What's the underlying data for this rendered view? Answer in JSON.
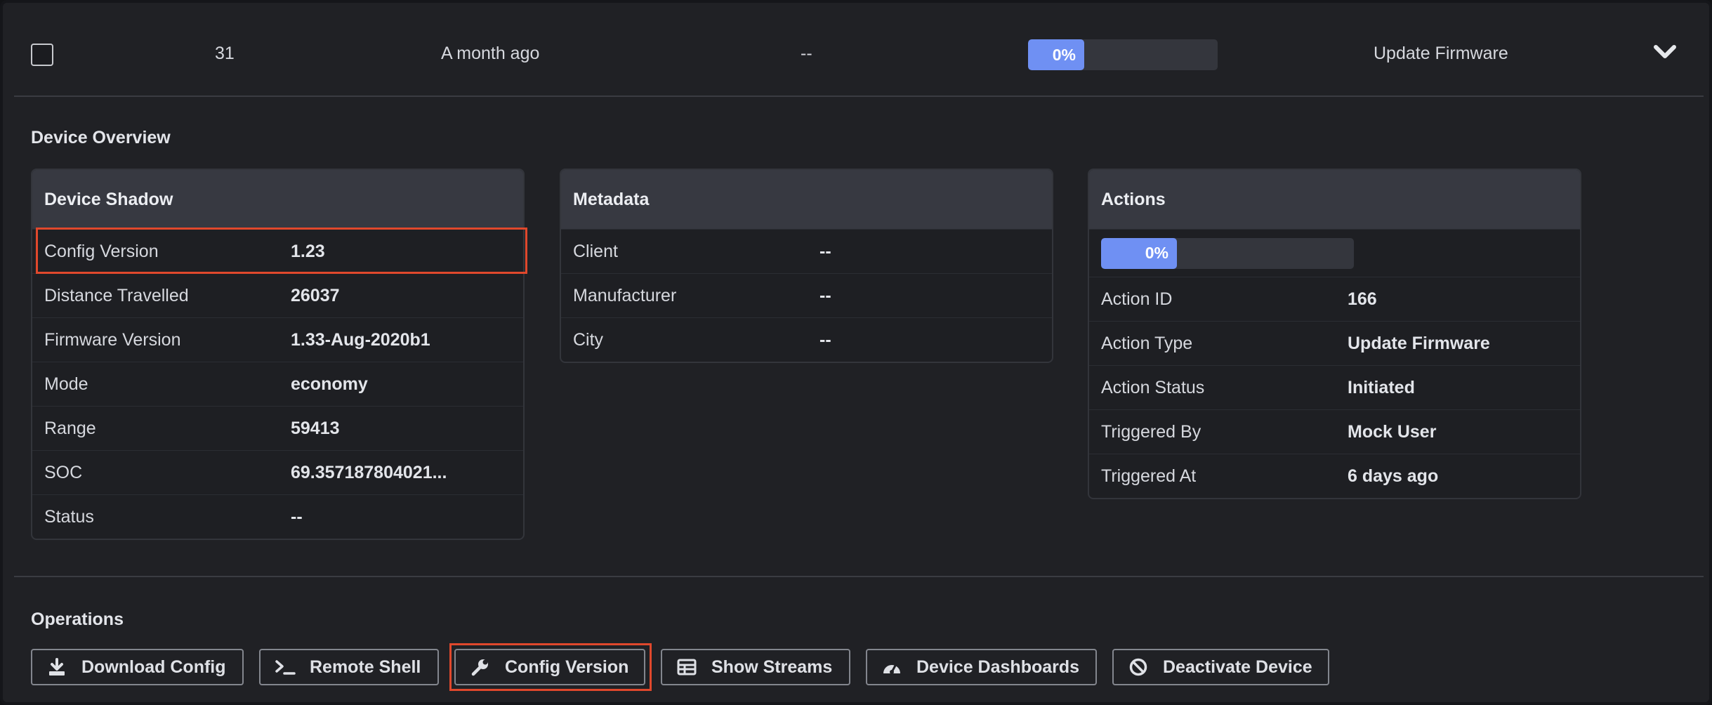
{
  "summary": {
    "count": "31",
    "time": "A month ago",
    "dash": "--",
    "progress_label": "0%",
    "progress_value": 0,
    "action": "Update Firmware"
  },
  "device_overview": {
    "title": "Device Overview",
    "device_shadow": {
      "title": "Device Shadow",
      "rows": [
        {
          "key": "Config Version",
          "value": "1.23"
        },
        {
          "key": "Distance Travelled",
          "value": "26037"
        },
        {
          "key": "Firmware Version",
          "value": "1.33-Aug-2020b1"
        },
        {
          "key": "Mode",
          "value": "economy"
        },
        {
          "key": "Range",
          "value": "59413"
        },
        {
          "key": "SOC",
          "value": "69.357187804021..."
        },
        {
          "key": "Status",
          "value": "--"
        }
      ]
    },
    "metadata": {
      "title": "Metadata",
      "rows": [
        {
          "key": "Client",
          "value": "--"
        },
        {
          "key": "Manufacturer",
          "value": "--"
        },
        {
          "key": "City",
          "value": "--"
        }
      ]
    },
    "actions": {
      "title": "Actions",
      "progress_label": "0%",
      "progress_value": 0,
      "rows": [
        {
          "key": "Action ID",
          "value": "166"
        },
        {
          "key": "Action Type",
          "value": "Update Firmware"
        },
        {
          "key": "Action Status",
          "value": "Initiated"
        },
        {
          "key": "Triggered By",
          "value": "Mock User"
        },
        {
          "key": "Triggered At",
          "value": "6 days ago"
        }
      ]
    }
  },
  "operations": {
    "title": "Operations",
    "buttons": [
      {
        "label": "Download Config",
        "icon": "download-icon"
      },
      {
        "label": "Remote Shell",
        "icon": "terminal-icon"
      },
      {
        "label": "Config Version",
        "icon": "wrench-icon"
      },
      {
        "label": "Show Streams",
        "icon": "table-icon"
      },
      {
        "label": "Device Dashboards",
        "icon": "gauge-icon"
      },
      {
        "label": "Deactivate Device",
        "icon": "ban-icon"
      }
    ]
  },
  "colors": {
    "accent": "#6f90f3",
    "highlight": "#e0482c",
    "background": "#202125",
    "card_header": "#373941"
  }
}
